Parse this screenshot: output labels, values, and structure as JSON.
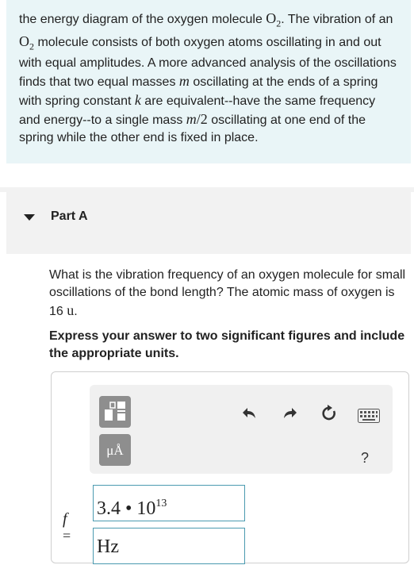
{
  "intro": {
    "t1": "the energy diagram of the oxygen molecule ",
    "o2_a_sym": "O",
    "o2_a_sub": "2",
    "t2": ". The vibration of an ",
    "o2_b_sym": "O",
    "o2_b_sub": "2",
    "t3": " molecule consists of both oxygen atoms oscillating in and out with equal amplitudes. A more advanced analysis of the oscillations finds that two equal masses ",
    "m1": "m",
    "t4": " oscillating at the ends of a spring with spring constant ",
    "k": "k",
    "t5": " are equivalent--have the same frequency and energy--to a single mass ",
    "m2": "m",
    "m2_div": "/2",
    "t6": " oscillating at one end of the spring while the other end is fixed in place."
  },
  "part": {
    "title": "Part A"
  },
  "question": {
    "t1": "What is the vibration frequency of an oxygen molecule for small oscillations of the bond length? The atomic mass of oxygen is 16 ",
    "unit": "u",
    "t2": ".",
    "instruction": "Express your answer to two significant figures and include the appropriate units."
  },
  "answer": {
    "units_button": "μÅ",
    "help_label": "?",
    "variable": "f",
    "equals": "=",
    "mantissa": "3.4 • 10",
    "exponent": "13",
    "unit": "Hz"
  },
  "icons": {
    "templates": "templates-icon",
    "undo": "undo-icon",
    "redo": "redo-icon",
    "reset": "reset-icon",
    "keyboard": "keyboard-icon"
  }
}
